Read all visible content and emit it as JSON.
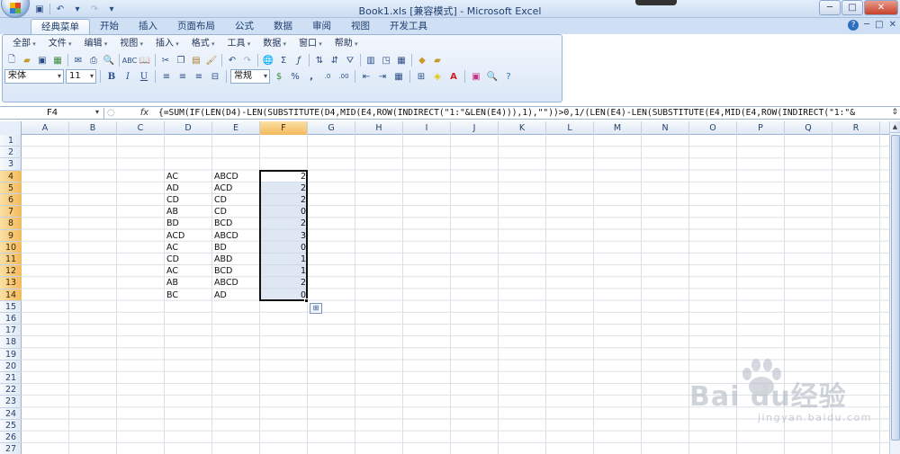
{
  "window": {
    "title": "Book1.xls  [兼容模式] - Microsoft Excel",
    "controls": [
      "─",
      "□",
      "✕"
    ]
  },
  "quick_access": {
    "save_icon": "save-icon",
    "undo_icon": "undo-icon",
    "redo_icon": "redo-icon"
  },
  "ribbon_tabs": [
    "经典菜单",
    "开始",
    "插入",
    "页面布局",
    "公式",
    "数据",
    "审阅",
    "视图",
    "开发工具"
  ],
  "active_tab": "经典菜单",
  "ribbon_right": {
    "help": "?",
    "min": "─",
    "restore": "□",
    "close": "✕"
  },
  "classic_menu": [
    "全部",
    "文件",
    "编辑",
    "视图",
    "插入",
    "格式",
    "工具",
    "数据",
    "窗口",
    "帮助"
  ],
  "format_toolbar": {
    "font_name": "宋体",
    "font_size": "11",
    "bold": "B",
    "italic": "I",
    "underline": "U",
    "number_format": "常规",
    "percent": "%",
    "comma": ","
  },
  "formula_bar": {
    "name_box": "F4",
    "fx_label": "fx",
    "formula": "{=SUM(IF(LEN(D4)-LEN(SUBSTITUTE(D4,MID(E4,ROW(INDIRECT(\"1:\"&LEN(E4))),1),\"\"))>0,1/(LEN(E4)-LEN(SUBSTITUTE(E4,MID(E4,ROW(INDIRECT(\"1:\"&"
  },
  "sheet": {
    "columns": [
      "A",
      "B",
      "C",
      "D",
      "E",
      "F",
      "G",
      "H",
      "I",
      "J",
      "K",
      "L",
      "M",
      "N",
      "O",
      "P",
      "Q",
      "R"
    ],
    "selected_column": "F",
    "rows": [
      "1",
      "2",
      "3",
      "4",
      "5",
      "6",
      "7",
      "8",
      "9",
      "10",
      "11",
      "12",
      "13",
      "14",
      "15",
      "16",
      "17",
      "18",
      "19",
      "20",
      "21",
      "22",
      "23",
      "24",
      "25",
      "26",
      "27"
    ],
    "selected_rows": [
      "4",
      "5",
      "6",
      "7",
      "8",
      "9",
      "10",
      "11",
      "12",
      "13",
      "14"
    ],
    "data_rows": [
      {
        "row": "4",
        "d": "AC",
        "e": "ABCD",
        "f": "2"
      },
      {
        "row": "5",
        "d": "AD",
        "e": "ACD",
        "f": "2"
      },
      {
        "row": "6",
        "d": "CD",
        "e": "CD",
        "f": "2"
      },
      {
        "row": "7",
        "d": "AB",
        "e": "CD",
        "f": "0"
      },
      {
        "row": "8",
        "d": "BD",
        "e": "BCD",
        "f": "2"
      },
      {
        "row": "9",
        "d": "ACD",
        "e": "ABCD",
        "f": "3"
      },
      {
        "row": "10",
        "d": "AC",
        "e": "BD",
        "f": "0"
      },
      {
        "row": "11",
        "d": "CD",
        "e": "ABD",
        "f": "1"
      },
      {
        "row": "12",
        "d": "AC",
        "e": "BCD",
        "f": "1"
      },
      {
        "row": "13",
        "d": "AB",
        "e": "ABCD",
        "f": "2"
      },
      {
        "row": "14",
        "d": "BC",
        "e": "AD",
        "f": "0"
      }
    ]
  },
  "watermark": {
    "brand": "Bai du经验",
    "url": "jingyan.baidu.com"
  }
}
